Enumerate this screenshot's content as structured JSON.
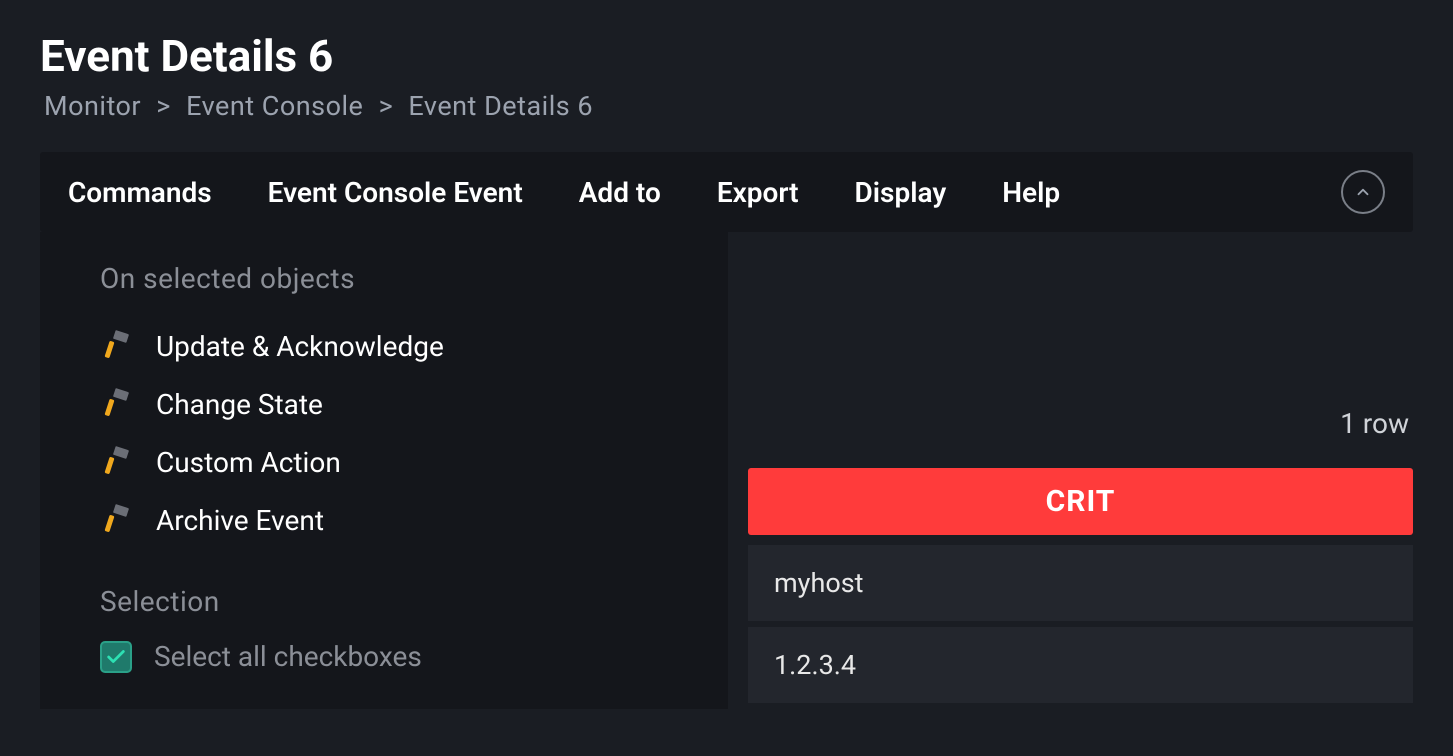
{
  "header": {
    "title": "Event Details 6",
    "breadcrumb": [
      "Monitor",
      "Event Console",
      "Event Details 6"
    ]
  },
  "menu": {
    "items": [
      "Commands",
      "Event Console Event",
      "Add to",
      "Export",
      "Display",
      "Help"
    ]
  },
  "dropdown": {
    "section1_label": "On selected objects",
    "commands": [
      "Update & Acknowledge",
      "Change State",
      "Custom Action",
      "Archive Event"
    ],
    "section2_label": "Selection",
    "select_all_label": "Select all checkboxes"
  },
  "detail": {
    "row_count": "1 row",
    "status": "CRIT",
    "host": "myhost",
    "ip": "1.2.3.4"
  },
  "colors": {
    "crit": "#ff3b3b"
  }
}
